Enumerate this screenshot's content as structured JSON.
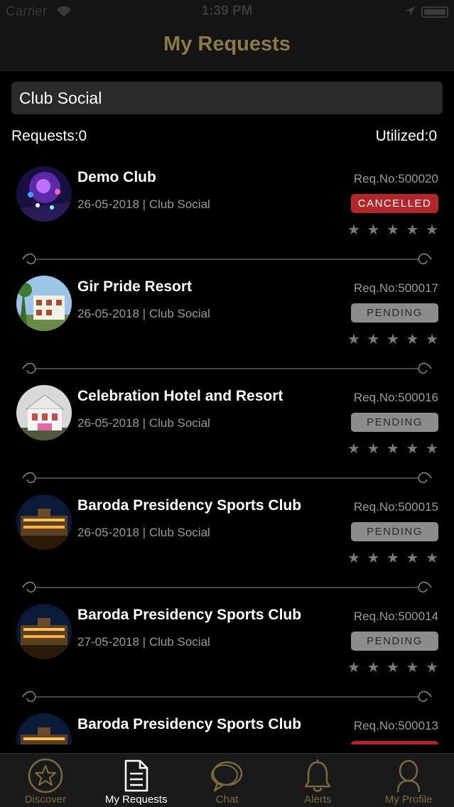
{
  "status_bar": {
    "carrier": "Carrier",
    "time": "1:39 PM"
  },
  "header": {
    "title": "My Requests"
  },
  "filter": {
    "selected": "Club Social"
  },
  "summary": {
    "requests": "Requests:0",
    "utilized": "Utilized:0"
  },
  "requests": [
    {
      "name": "Demo Club",
      "meta": "26-05-2018 | Club Social",
      "req_no": "Req.No:500020",
      "status": "CANCELLED",
      "rating": 0
    },
    {
      "name": "Gir Pride Resort",
      "meta": "26-05-2018 | Club Social",
      "req_no": "Req.No:500017",
      "status": "PENDING",
      "rating": 0
    },
    {
      "name": "Celebration Hotel and Resort",
      "meta": "26-05-2018 | Club Social",
      "req_no": "Req.No:500016",
      "status": "PENDING",
      "rating": 0
    },
    {
      "name": "Baroda Presidency Sports Club",
      "meta": "26-05-2018 | Club Social",
      "req_no": "Req.No:500015",
      "status": "PENDING",
      "rating": 0
    },
    {
      "name": "Baroda Presidency Sports Club",
      "meta": "27-05-2018 | Club Social",
      "req_no": "Req.No:500014",
      "status": "PENDING",
      "rating": 0
    },
    {
      "name": "Baroda Presidency Sports Club",
      "meta": "",
      "req_no": "Req.No:500013",
      "status": "",
      "rating": 0
    }
  ],
  "tabs": [
    {
      "label": "Discover",
      "icon": "star-circle-icon"
    },
    {
      "label": "My Requests",
      "icon": "document-icon"
    },
    {
      "label": "Chat",
      "icon": "chat-bubble-icon"
    },
    {
      "label": "Alerts",
      "icon": "bell-icon"
    },
    {
      "label": "My Profile",
      "icon": "profile-icon"
    }
  ],
  "colors": {
    "gold": "#8a7a48",
    "cancelled": "#b2272b",
    "pending": "#8c8c8c"
  }
}
